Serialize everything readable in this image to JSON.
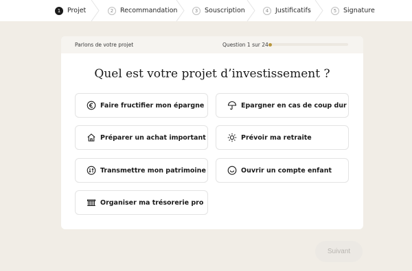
{
  "stepper": {
    "steps": [
      {
        "num": "1",
        "label": "Projet",
        "active": true
      },
      {
        "num": "2",
        "label": "Recommandation",
        "active": false
      },
      {
        "num": "3",
        "label": "Souscription",
        "active": false
      },
      {
        "num": "4",
        "label": "Justificatifs",
        "active": false
      },
      {
        "num": "5",
        "label": "Signature",
        "active": false
      }
    ]
  },
  "card": {
    "header_label": "Parlons de votre projet",
    "question_count": "Question 1 sur 24",
    "progress": 0.04,
    "title": "Quel est votre projet d’investissement ?",
    "options": [
      {
        "label": "Faire fructifier mon épargne",
        "icon": "euro-icon"
      },
      {
        "label": "Epargner en cas de coup dur",
        "icon": "umbrella-icon"
      },
      {
        "label": "Préparer un achat important",
        "icon": "house-icon"
      },
      {
        "label": "Prévoir ma retraite",
        "icon": "sun-icon"
      },
      {
        "label": "Transmettre mon patrimoine",
        "icon": "transfer-icon"
      },
      {
        "label": "Ouvrir un compte enfant",
        "icon": "smile-icon"
      },
      {
        "label": "Organiser ma trésorerie pro",
        "icon": "bank-icon"
      }
    ]
  },
  "next_button": {
    "label": "Suivant"
  },
  "colors": {
    "background": "#f1ede6",
    "accent": "#b8963e",
    "text": "#1a1a1a"
  }
}
